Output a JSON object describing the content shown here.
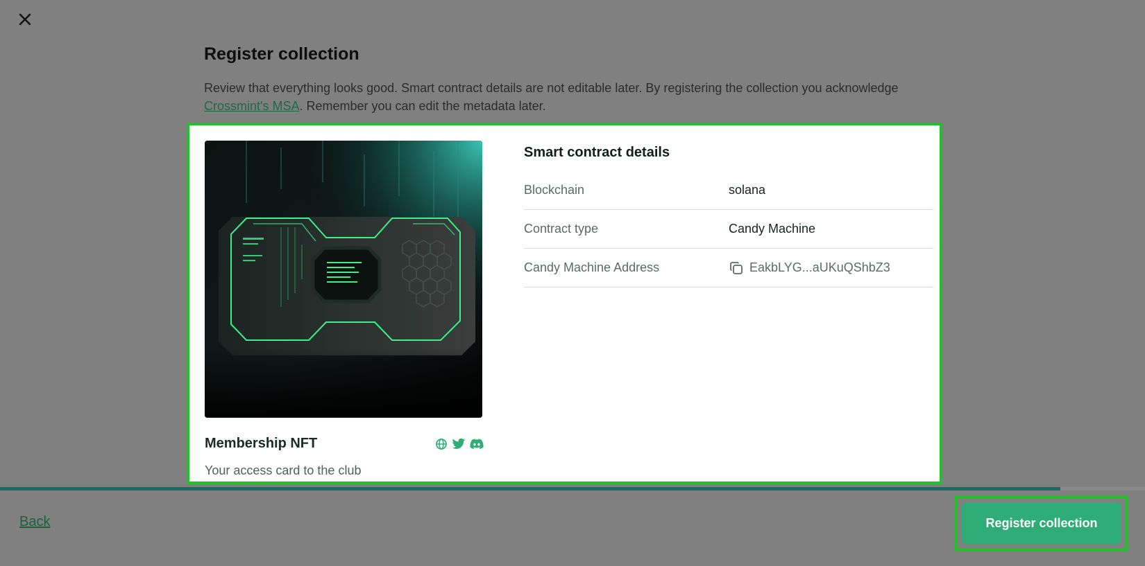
{
  "header": {
    "close_icon": "close-icon",
    "title": "Register collection",
    "intro_text": "Review that everything looks good. Smart contract details are not editable later. By registering the collection you acknowledge ",
    "intro_link": "Crossmint's MSA",
    "intro_text_after": ". Remember you can edit the metadata later."
  },
  "collection": {
    "name": "Membership NFT",
    "description": "Your access card to the club",
    "socials": [
      "globe-icon",
      "twitter-icon",
      "discord-icon"
    ],
    "accent_color": "#2eae76"
  },
  "contract": {
    "title": "Smart contract details",
    "rows": [
      {
        "label": "Blockchain",
        "value": "solana"
      },
      {
        "label": "Contract type",
        "value": "Candy Machine"
      },
      {
        "label": "Candy Machine Address",
        "value": "EakbLYG...aUKuQShbZ3",
        "icon": "copy-icon"
      }
    ]
  },
  "progress": {
    "value": 0.926,
    "fill_color": "#176b60"
  },
  "footer": {
    "back_label": "Back",
    "register_label": "Register collection",
    "highlight_color": "#22c02a"
  }
}
